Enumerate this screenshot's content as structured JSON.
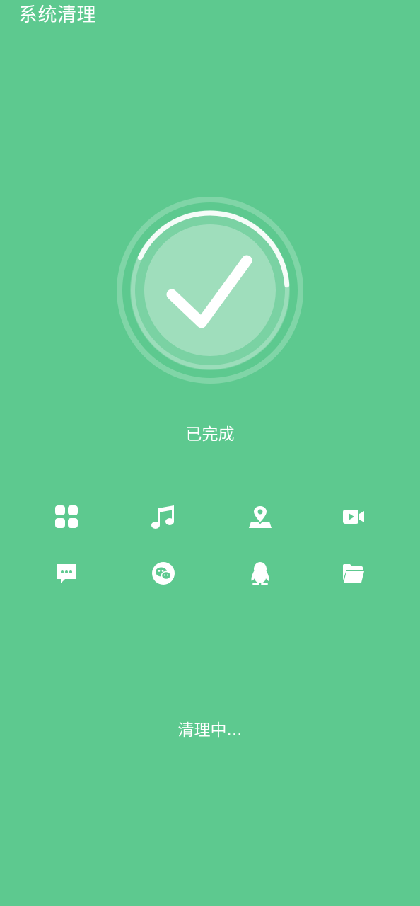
{
  "header": {
    "title": "系统清理"
  },
  "progress": {
    "status_label": "已完成",
    "fraction": 0.42
  },
  "icons": [
    "apps-icon",
    "music-note-icon",
    "map-pin-icon",
    "video-camera-icon",
    "chat-bubble-icon",
    "wechat-icon",
    "qq-penguin-icon",
    "folder-icon"
  ],
  "footer": {
    "status_text": "清理中..."
  },
  "colors": {
    "background": "#5DC98F",
    "foreground": "#FFFFFF"
  }
}
